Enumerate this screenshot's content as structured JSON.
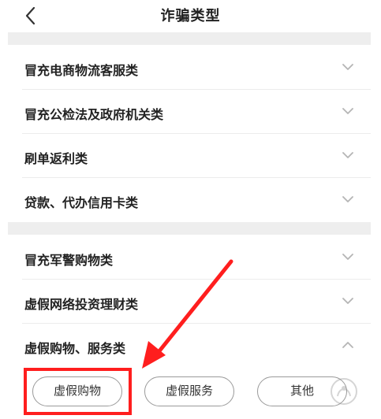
{
  "header": {
    "title": "诈骗类型",
    "back_icon": "chevron-left-icon"
  },
  "sections": [
    {
      "rows": [
        {
          "label": "冒充电商物流客服类",
          "expanded": false
        },
        {
          "label": "冒充公检法及政府机关类",
          "expanded": false
        },
        {
          "label": "刷单返利类",
          "expanded": false
        },
        {
          "label": "贷款、代办信用卡类",
          "expanded": false
        }
      ]
    },
    {
      "rows": [
        {
          "label": "冒充军警购物类",
          "expanded": false
        },
        {
          "label": "虚假网络投资理财类",
          "expanded": false
        },
        {
          "label": "虚假购物、服务类",
          "expanded": true
        }
      ]
    }
  ],
  "subcategories": [
    "虚假购物",
    "虚假服务",
    "其他"
  ],
  "highlight": {
    "color": "#ff1e1e",
    "target": "虚假购物"
  },
  "colors": {
    "section_gap": "#eeeeee",
    "text": "#222222",
    "chevron": "#b5b5b5"
  }
}
